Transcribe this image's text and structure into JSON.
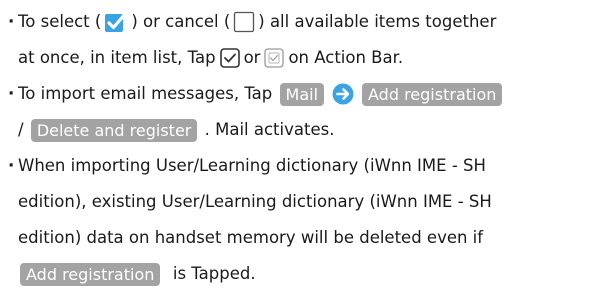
{
  "colors": {
    "accent": "#3aa3e3",
    "button_bg": "#a3a3a3",
    "text": "#1a1a1a"
  },
  "bullet_glyph": "·",
  "items": [
    {
      "l1_a": "To select (",
      "l1_b": ") or cancel (",
      "l1_c": ") all available items together",
      "l2_a": "at once, in item list, Tap",
      "l2_b": "or",
      "l2_c": "on Action Bar."
    },
    {
      "l1_a": "To import email messages, Tap",
      "btn_mail": "Mail",
      "btn_add": "Add registration",
      "l2_a": "/",
      "btn_delete": "Delete and register",
      "l2_b": ". Mail activates."
    },
    {
      "l1": "When importing User/Learning dictionary (iWnn IME - SH",
      "l2": "edition), existing User/Learning dictionary (iWnn IME - SH",
      "l3": "edition) data on handset memory will be deleted even if",
      "btn_add": "Add registration",
      "l4_b": "is Tapped."
    }
  ],
  "icons": [
    "checked-box-icon",
    "empty-box-icon",
    "check-all-icon",
    "uncheck-all-icon",
    "arrow-right-circle-icon"
  ]
}
